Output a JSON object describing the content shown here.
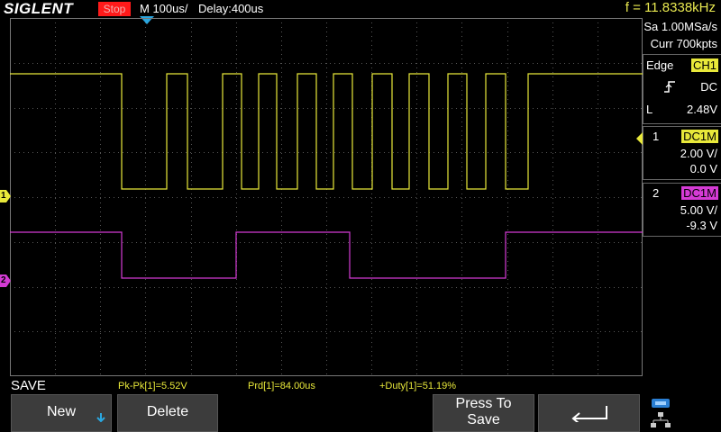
{
  "topbar": {
    "brand": "SIGLENT",
    "run_state": "Stop",
    "timebase": "M 100us/",
    "delay": "Delay:400us",
    "frequency": "f = 11.8338kHz"
  },
  "acquisition": {
    "sample_rate": "Sa 1.00MSa/s",
    "memory": "Curr 700kpts"
  },
  "trigger": {
    "type": "Edge",
    "source": "CH1",
    "coupling": "DC",
    "level_label": "L",
    "level": "2.48V"
  },
  "channel1": {
    "number": "1",
    "coupling": "DC1M",
    "scale": "2.00 V/",
    "offset": "0.0 V",
    "marker": "1",
    "color": "#e8e83a"
  },
  "channel2": {
    "number": "2",
    "coupling": "DC1M",
    "scale": "5.00 V/",
    "offset": "-9.3 V",
    "marker": "2",
    "color": "#d43bd4"
  },
  "bottom": {
    "menu_title": "SAVE",
    "measurements": {
      "pkpk": "Pk-Pk[1]=5.52V",
      "prd": "Prd[1]=84.00us",
      "duty": "+Duty[1]=51.19%"
    },
    "buttons": {
      "new": "New",
      "delete": "Delete",
      "press_line1": "Press To",
      "press_line2": "Save",
      "back_icon": "return-arrow-icon"
    },
    "status_icons": [
      "usb-icon",
      "network-icon"
    ]
  }
}
